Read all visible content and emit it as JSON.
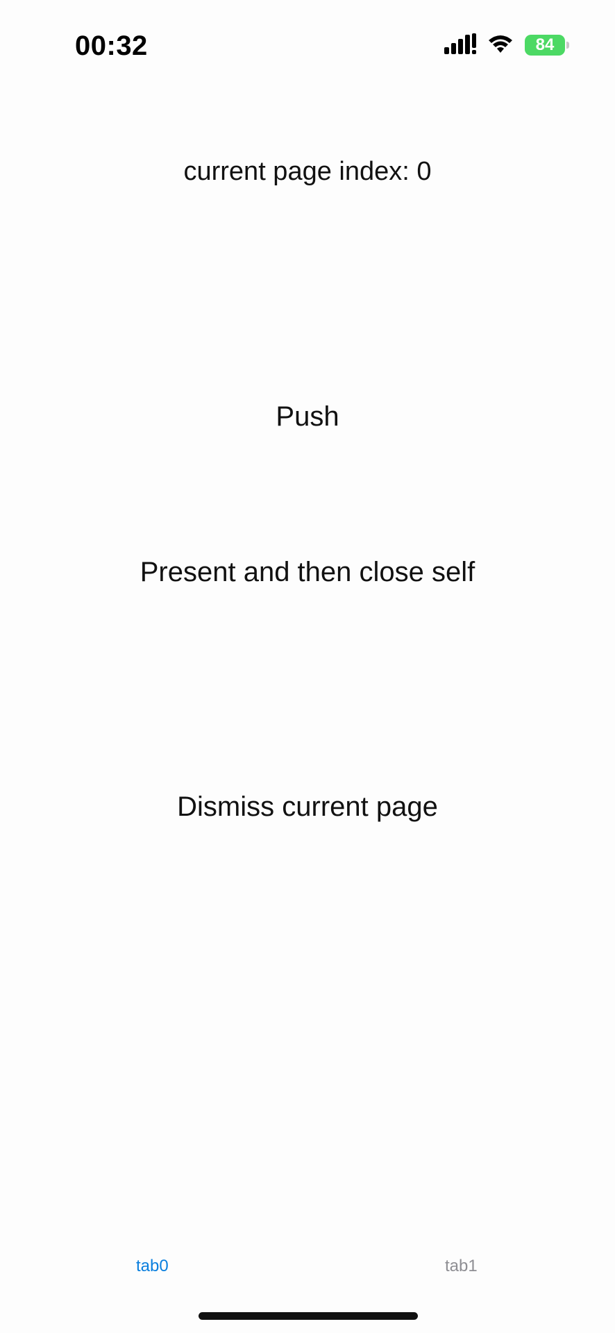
{
  "status_bar": {
    "time": "00:32",
    "battery_level": "84",
    "icons": [
      "signal-icon",
      "wifi-icon",
      "battery-icon",
      "charging-bolt-icon"
    ],
    "battery_color": "#4cd964"
  },
  "main": {
    "page_index_text": "current page index: 0",
    "push_label": "Push",
    "present_label": "Present and then close self",
    "dismiss_label": "Dismiss current page"
  },
  "tab_bar": {
    "tabs": [
      {
        "label": "tab0",
        "selected": true
      },
      {
        "label": "tab1",
        "selected": false
      }
    ],
    "active_color": "#0a7fde",
    "inactive_color": "#8e8e93"
  }
}
